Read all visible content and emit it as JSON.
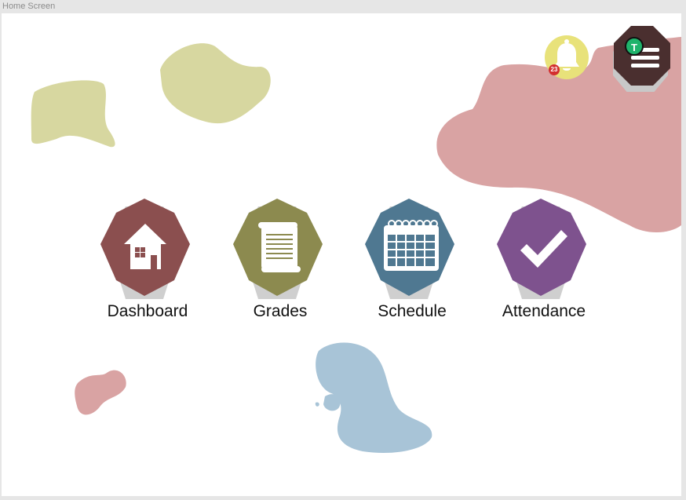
{
  "window": {
    "title": "Home Screen"
  },
  "header": {
    "notifications": {
      "count": "23",
      "icon": "bell-icon"
    },
    "profile": {
      "initial": "T",
      "icon": "menu-lines-icon"
    }
  },
  "tiles": [
    {
      "label": "Dashboard",
      "icon": "house-icon",
      "color": "#8b4f4f"
    },
    {
      "label": "Grades",
      "icon": "scroll-icon",
      "color": "#8c8a4f"
    },
    {
      "label": "Schedule",
      "icon": "calendar-icon",
      "color": "#4f7891"
    },
    {
      "label": "Attendance",
      "icon": "checkmark-icon",
      "color": "#7e528e"
    }
  ],
  "colors": {
    "blob_olive": "#d7d7a0",
    "blob_pink": "#d9a3a3",
    "blob_blue": "#a8c4d7",
    "bell_bg": "#e8e27a",
    "profile_bg": "#4a2f2f",
    "badge": "#d32f2f",
    "avatar": "#1fb36b"
  }
}
